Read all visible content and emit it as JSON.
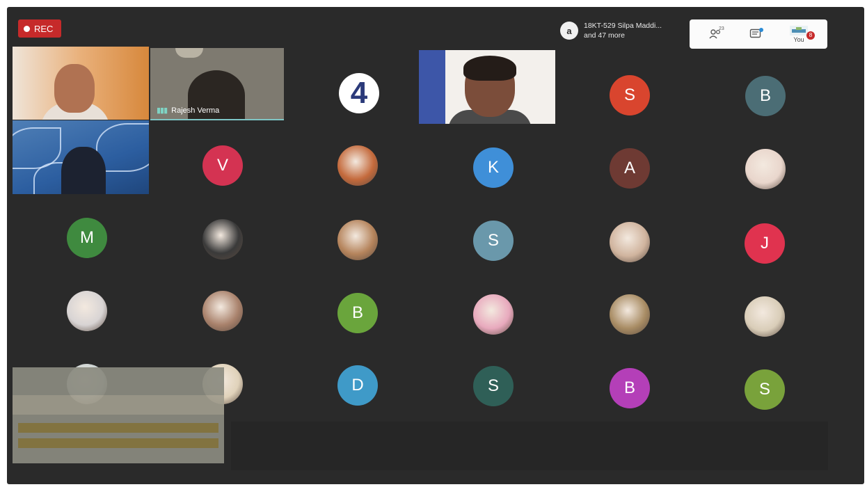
{
  "recording": {
    "label": "REC"
  },
  "presenter": {
    "avatar_letter": "a",
    "name": "18KT-529 Silpa Maddi...",
    "more": "and 47 more"
  },
  "toolbar": {
    "people_count": "23",
    "you_label": "You",
    "notification_count": "8"
  },
  "video_tiles": [
    {
      "name": ""
    },
    {
      "name": "Rajesh Verma"
    },
    {
      "name": ""
    },
    {
      "name": ""
    }
  ],
  "avatar_tiles": [
    {
      "letter": "4",
      "color": "#ffffff",
      "text_color": "#2b3a7a",
      "kind": "logo"
    },
    {
      "letter": "S",
      "color": "#d9452e",
      "kind": "letter"
    },
    {
      "letter": "B",
      "color": "#4b6d75",
      "kind": "letter"
    },
    {
      "letter": "V",
      "color": "#d43352",
      "kind": "letter"
    },
    {
      "letter": "",
      "color": "#c46a3c",
      "kind": "photo"
    },
    {
      "letter": "K",
      "color": "#3f8fd8",
      "kind": "letter"
    },
    {
      "letter": "A",
      "color": "#6e3a33",
      "kind": "letter"
    },
    {
      "letter": "",
      "color": "#e9d6cc",
      "kind": "photo"
    },
    {
      "letter": "M",
      "color": "#3f8a3f",
      "kind": "letter"
    },
    {
      "letter": "",
      "color": "#3a3a3a",
      "kind": "photo"
    },
    {
      "letter": "",
      "color": "#b5845c",
      "kind": "photo"
    },
    {
      "letter": "S",
      "color": "#6a98ab",
      "kind": "letter"
    },
    {
      "letter": "",
      "color": "#d0b49e",
      "kind": "photo"
    },
    {
      "letter": "J",
      "color": "#e0334f",
      "kind": "letter"
    },
    {
      "letter": "",
      "color": "#d8d4d4",
      "kind": "photo"
    },
    {
      "letter": "",
      "color": "#a9826c",
      "kind": "photo"
    },
    {
      "letter": "B",
      "color": "#6aa53c",
      "kind": "letter"
    },
    {
      "letter": "",
      "color": "#e8a9bd",
      "kind": "photo"
    },
    {
      "letter": "",
      "color": "#a88c64",
      "kind": "photo"
    },
    {
      "letter": "",
      "color": "#d9cdb8",
      "kind": "photo"
    },
    {
      "letter": "",
      "color": "#cbd3d3",
      "kind": "photo"
    },
    {
      "letter": "",
      "color": "#e0d2ba",
      "kind": "photo"
    },
    {
      "letter": "D",
      "color": "#3f9ac8",
      "kind": "letter"
    },
    {
      "letter": "S",
      "color": "#2f5f57",
      "kind": "letter"
    },
    {
      "letter": "B",
      "color": "#b43fb8",
      "kind": "letter"
    },
    {
      "letter": "S",
      "color": "#79a23b",
      "kind": "letter"
    }
  ],
  "colors": {
    "background": "#2a2a2a",
    "rec": "#c62a2a",
    "active_speaker": "#7fc6c6"
  }
}
